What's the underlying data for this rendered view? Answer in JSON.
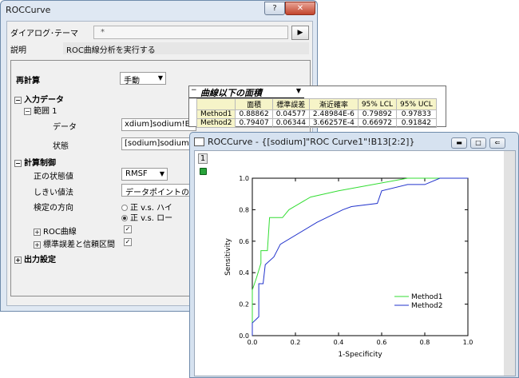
{
  "dialog": {
    "title": "ROCCurve",
    "help_label": "?",
    "close_label": "✕",
    "theme_label": "ダイアログ･テーマ",
    "theme_value": "*",
    "theme_arrow": "▶",
    "desc_label": "説明",
    "desc_value": "ROC曲線分析を実行する",
    "recalc_label": "再計算",
    "recalc_value": "手動",
    "input_data_label": "入力データ",
    "range_label": "範囲 1",
    "data_label": "データ",
    "data_value": "xdium]sodium!B\"Me",
    "state_label": "状態",
    "state_value": "[sodium]sodium!A\"Ty",
    "calc_control_label": "計算制御",
    "positive_state_label": "正の状態値",
    "positive_state_value": "RMSF",
    "threshold_label": "しきい値法",
    "threshold_value": "データポイントの補間",
    "test_direction_label": "検定の方向",
    "radio_high": "正 v.s. ハイ",
    "radio_low": "正 v.s. ロー",
    "roc_curve_label": "ROC曲線",
    "se_ci_label": "標準誤差と信頼区間",
    "output_settings_label": "出力設定"
  },
  "area_table": {
    "title": "曲線以下の面積",
    "columns": [
      "",
      "面積",
      "標準誤差",
      "漸近確率",
      "95% LCL",
      "95% UCL"
    ],
    "rows": [
      [
        "Method1",
        "0.88862",
        "0.04577",
        "2.48984E-6",
        "0.79892",
        "0.97833"
      ],
      [
        "Method2",
        "0.79407",
        "0.06344",
        "3.66257E-4",
        "0.66972",
        "0.91842"
      ]
    ]
  },
  "graph_window": {
    "title": "ROCCurve - {[sodium]\"ROC Curve1\"!B13[2:2]}",
    "layer_number": "1",
    "min_label": "▬",
    "max_label": "□",
    "restore_label": "⇐"
  },
  "chart_data": {
    "type": "line",
    "xlabel": "1-Specificity",
    "ylabel": "Sensitivity",
    "xlim": [
      0,
      1.0
    ],
    "ylim": [
      0,
      1.0
    ],
    "xticks": [
      "0.0",
      "0.2",
      "0.4",
      "0.6",
      "0.8",
      "1.0"
    ],
    "yticks": [
      "0.0",
      "0.2",
      "0.4",
      "0.6",
      "0.8",
      "1.0"
    ],
    "legend_position": "lower-right",
    "series": [
      {
        "name": "Method1",
        "color": "#33dd33",
        "points": [
          [
            0,
            0
          ],
          [
            0,
            0.29
          ],
          [
            0.02,
            0.37
          ],
          [
            0.04,
            0.46
          ],
          [
            0.04,
            0.54
          ],
          [
            0.07,
            0.54
          ],
          [
            0.08,
            0.75
          ],
          [
            0.14,
            0.75
          ],
          [
            0.17,
            0.8
          ],
          [
            0.27,
            0.88
          ],
          [
            0.4,
            0.92
          ],
          [
            0.56,
            0.96
          ],
          [
            0.72,
            1.0
          ],
          [
            1.0,
            1.0
          ]
        ]
      },
      {
        "name": "Method2",
        "color": "#2233cc",
        "points": [
          [
            0,
            0
          ],
          [
            0,
            0.08
          ],
          [
            0.03,
            0.12
          ],
          [
            0.03,
            0.33
          ],
          [
            0.05,
            0.33
          ],
          [
            0.06,
            0.45
          ],
          [
            0.1,
            0.5
          ],
          [
            0.13,
            0.58
          ],
          [
            0.3,
            0.72
          ],
          [
            0.42,
            0.8
          ],
          [
            0.46,
            0.82
          ],
          [
            0.58,
            0.84
          ],
          [
            0.6,
            0.92
          ],
          [
            0.72,
            0.96
          ],
          [
            0.8,
            0.96
          ],
          [
            0.87,
            1.0
          ],
          [
            1.0,
            1.0
          ]
        ]
      }
    ]
  }
}
